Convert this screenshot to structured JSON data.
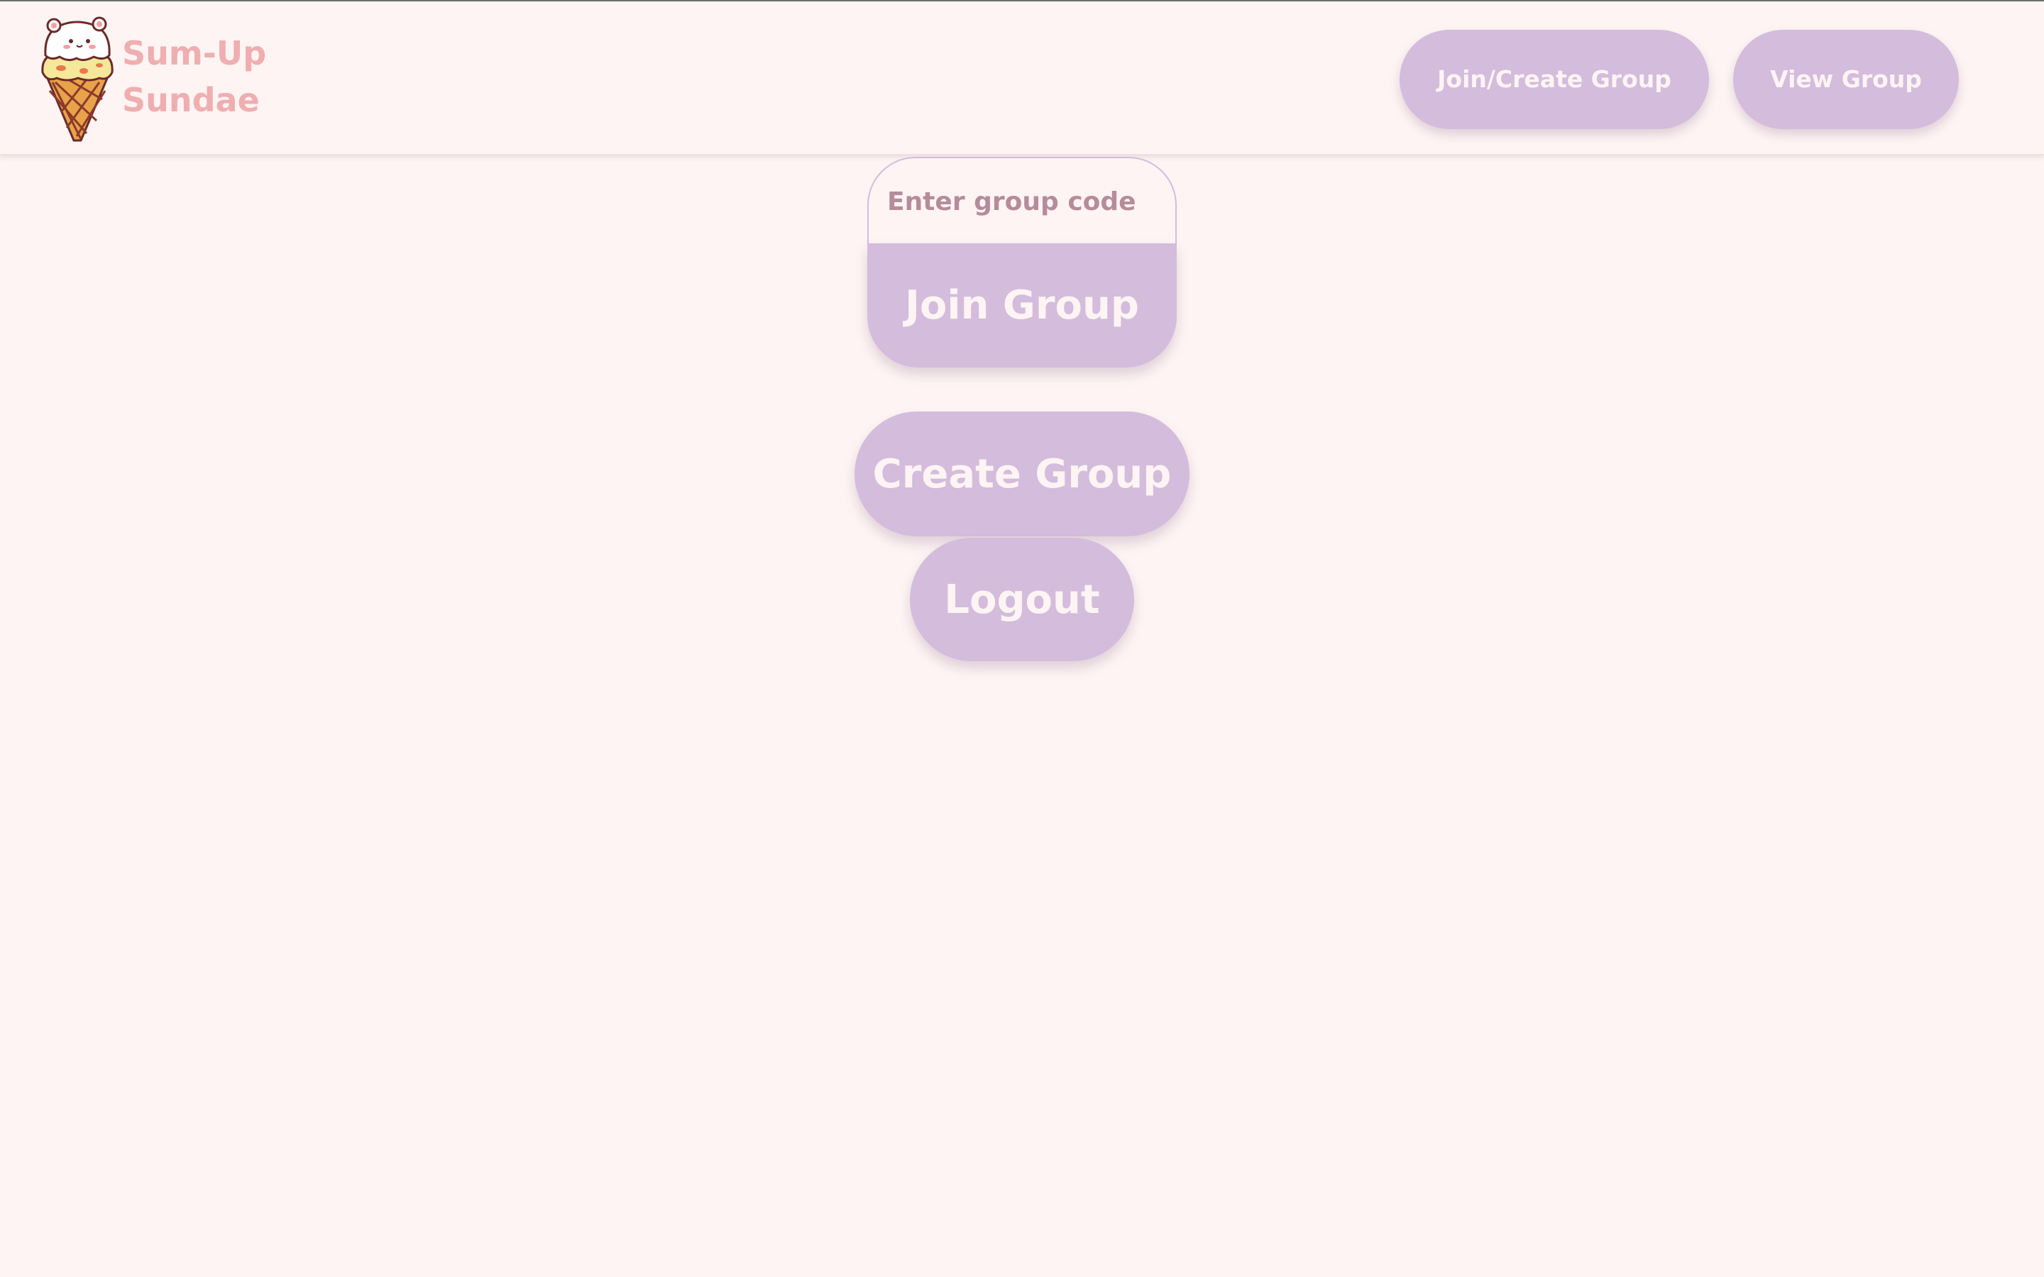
{
  "brand": {
    "name_line1": "Sum-Up",
    "name_line2": "Sundae",
    "logo_icon": "ice-cream-cone-icon"
  },
  "nav": {
    "join_create_label": "Join/Create Group",
    "view_label": "View Group"
  },
  "join": {
    "code_placeholder": "Enter group code",
    "code_value": "",
    "button_label": "Join Group"
  },
  "create": {
    "button_label": "Create Group"
  },
  "logout": {
    "button_label": "Logout"
  },
  "colors": {
    "background": "#fdf4f3",
    "button": "#d4bcdd",
    "button_text": "#fdf4f3",
    "brand_text": "#efaeb0",
    "placeholder_text": "#b58c9c"
  }
}
